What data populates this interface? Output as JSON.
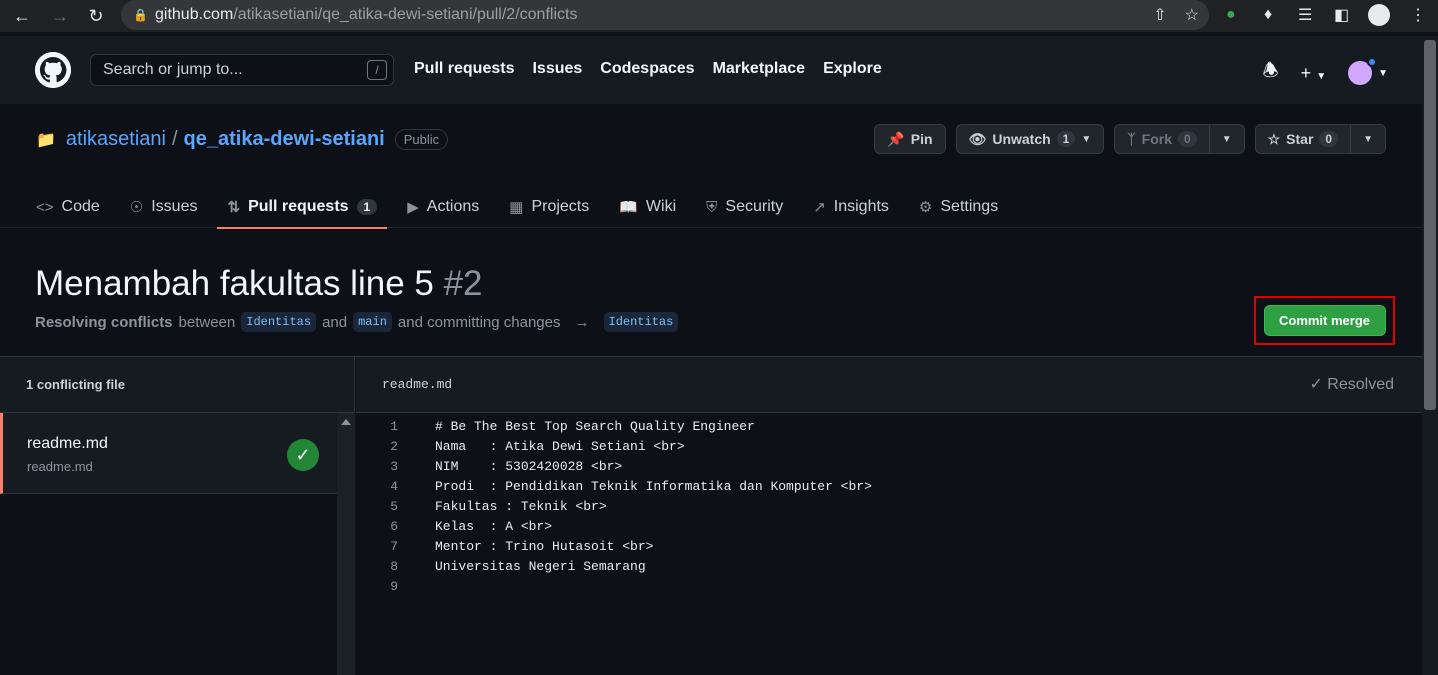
{
  "browser": {
    "url_host": "github.com",
    "url_path": "/atikasetiani/qe_atika-dewi-setiani/pull/2/conflicts"
  },
  "header": {
    "search_placeholder": "Search or jump to...",
    "search_key": "/",
    "nav": [
      "Pull requests",
      "Issues",
      "Codespaces",
      "Marketplace",
      "Explore"
    ],
    "plus_label": "+"
  },
  "repo": {
    "owner": "atikasetiani",
    "separator": "/",
    "name": "qe_atika-dewi-setiani",
    "visibility": "Public",
    "pin_label": "Pin",
    "unwatch_label": "Unwatch",
    "watch_count": "1",
    "fork_label": "Fork",
    "fork_count": "0",
    "star_label": "Star",
    "star_count": "0"
  },
  "tabs": [
    {
      "label": "Code",
      "icon": "code-icon"
    },
    {
      "label": "Issues",
      "icon": "issues-icon"
    },
    {
      "label": "Pull requests",
      "icon": "pull-request-icon",
      "count": "1",
      "active": true
    },
    {
      "label": "Actions",
      "icon": "play-icon"
    },
    {
      "label": "Projects",
      "icon": "table-icon"
    },
    {
      "label": "Wiki",
      "icon": "book-icon"
    },
    {
      "label": "Security",
      "icon": "shield-icon"
    },
    {
      "label": "Insights",
      "icon": "graph-icon"
    },
    {
      "label": "Settings",
      "icon": "gear-icon"
    }
  ],
  "pr": {
    "title": "Menambah fakultas line 5",
    "number": "#2",
    "subtitle_strong": "Resolving conflicts",
    "subtitle_between": "between",
    "head_branch": "Identitas",
    "and_text": "and",
    "base_branch": "main",
    "committing_text": "and committing changes",
    "arrow": "→",
    "target_branch": "Identitas",
    "commit_button": "Commit merge"
  },
  "conflicts": {
    "files_header": "1 conflicting file",
    "file": {
      "name": "readme.md",
      "path": "readme.md",
      "resolved": true
    },
    "editor_filename": "readme.md",
    "resolved_label": "Resolved",
    "lines": [
      {
        "n": "1",
        "text": "# Be The Best Top Search Quality Engineer"
      },
      {
        "n": "2",
        "text": "Nama   : Atika Dewi Setiani <br>"
      },
      {
        "n": "3",
        "text": "NIM    : 5302420028 <br>"
      },
      {
        "n": "4",
        "text": "Prodi  : Pendidikan Teknik Informatika dan Komputer <br>"
      },
      {
        "n": "5",
        "text": "Fakultas : Teknik <br>"
      },
      {
        "n": "6",
        "text": "Kelas  : A <br>"
      },
      {
        "n": "7",
        "text": "Mentor : Trino Hutasoit <br>"
      },
      {
        "n": "8",
        "text": "Universitas Negeri Semarang"
      },
      {
        "n": "9",
        "text": ""
      }
    ]
  },
  "colors": {
    "accent_link": "#58a6ff",
    "commit_button": "#2ea043",
    "highlight_box": "#e00000",
    "active_tab_underline": "#f78166"
  }
}
